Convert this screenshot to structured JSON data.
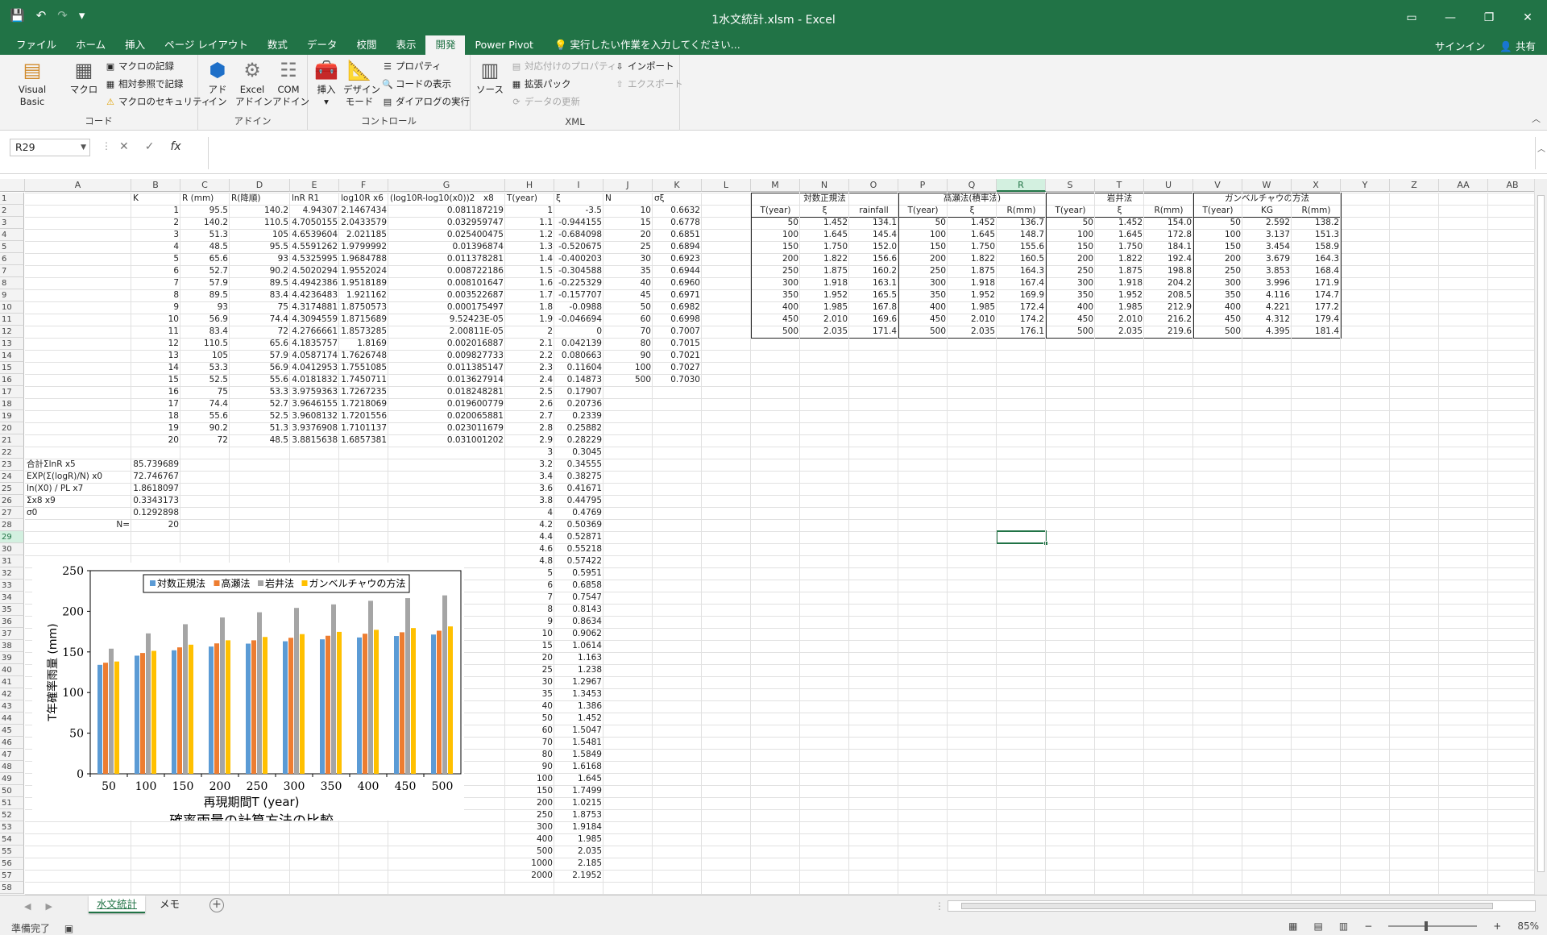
{
  "titlebar": {
    "title": "1水文統計.xlsm - Excel",
    "undo": "↶",
    "redo": "↷",
    "save": "💾",
    "customize": "▾"
  },
  "menu": {
    "tabs": [
      "ファイル",
      "ホーム",
      "挿入",
      "ページ レイアウト",
      "数式",
      "データ",
      "校閲",
      "表示",
      "開発",
      "Power Pivot"
    ],
    "active_index": 8,
    "tellme": "実行したい作業を入力してください...",
    "signin": "サインイン",
    "share": "共有"
  },
  "ribbon": {
    "code": {
      "label": "コード",
      "visual_basic": "Visual Basic",
      "macro": "マクロ",
      "record": "マクロの記録",
      "relative": "相対参照で記録",
      "security": "マクロのセキュリティ"
    },
    "addin": {
      "label": "アドイン",
      "addin": "アド\nイン",
      "excel_addin": "Excel\nアドイン",
      "com_addin": "COM\nアドイン"
    },
    "controls": {
      "label": "コントロール",
      "insert": "挿入",
      "design": "デザイン\nモード",
      "properties": "プロパティ",
      "view_code": "コードの表示",
      "dialog": "ダイアログの実行"
    },
    "xml": {
      "label": "XML",
      "source": "ソース",
      "map_props": "対応付けのプロパティ",
      "expansion": "拡張パック",
      "refresh": "データの更新",
      "import": "インポート",
      "export": "エクスポート"
    }
  },
  "namebox": "R29",
  "formula": "",
  "columns": [
    {
      "n": "A",
      "w": 132
    },
    {
      "n": "B",
      "w": 61
    },
    {
      "n": "C",
      "w": 61
    },
    {
      "n": "D",
      "w": 75
    },
    {
      "n": "E",
      "w": 61
    },
    {
      "n": "F",
      "w": 61
    },
    {
      "n": "G",
      "w": 145
    },
    {
      "n": "H",
      "w": 61
    },
    {
      "n": "I",
      "w": 61
    },
    {
      "n": "J",
      "w": 61
    },
    {
      "n": "K",
      "w": 61
    },
    {
      "n": "L",
      "w": 61
    },
    {
      "n": "M",
      "w": 61
    },
    {
      "n": "N",
      "w": 61
    },
    {
      "n": "O",
      "w": 61
    },
    {
      "n": "P",
      "w": 61
    },
    {
      "n": "Q",
      "w": 61
    },
    {
      "n": "R",
      "w": 61
    },
    {
      "n": "S",
      "w": 61
    },
    {
      "n": "T",
      "w": 61
    },
    {
      "n": "U",
      "w": 61
    },
    {
      "n": "V",
      "w": 61
    },
    {
      "n": "W",
      "w": 61
    },
    {
      "n": "X",
      "w": 61
    },
    {
      "n": "Y",
      "w": 61
    },
    {
      "n": "Z",
      "w": 61
    },
    {
      "n": "AA",
      "w": 61
    },
    {
      "n": "AB",
      "w": 61
    }
  ],
  "selected_col": "R",
  "selected_row": 29,
  "main_headers": {
    "B": "K",
    "C": "R (mm)",
    "D": "R(降順)",
    "E": "lnR R1",
    "F": "log10R x6",
    "G": "(log10R-log10(x0))2　x8",
    "H": "T(year)",
    "I": "ξ",
    "J": "N",
    "K": "σξ"
  },
  "main_rows": [
    [
      "1",
      "95.5",
      "140.2",
      "4.94307",
      "2.1467434",
      "0.081187219"
    ],
    [
      "2",
      "140.2",
      "110.5",
      "4.7050155",
      "2.0433579",
      "0.032959747"
    ],
    [
      "3",
      "51.3",
      "105",
      "4.6539604",
      "2.021185",
      "0.025400475"
    ],
    [
      "4",
      "48.5",
      "95.5",
      "4.5591262",
      "1.9799992",
      "0.01396874"
    ],
    [
      "5",
      "65.6",
      "93",
      "4.5325995",
      "1.9684788",
      "0.011378281"
    ],
    [
      "6",
      "52.7",
      "90.2",
      "4.5020294",
      "1.9552024",
      "0.008722186"
    ],
    [
      "7",
      "57.9",
      "89.5",
      "4.4942386",
      "1.9518189",
      "0.008101647"
    ],
    [
      "8",
      "89.5",
      "83.4",
      "4.4236483",
      "1.921162",
      "0.003522687"
    ],
    [
      "9",
      "93",
      "75",
      "4.3174881",
      "1.8750573",
      "0.000175497"
    ],
    [
      "10",
      "56.9",
      "74.4",
      "4.3094559",
      "1.8715689",
      "9.52423E-05"
    ],
    [
      "11",
      "83.4",
      "72",
      "4.2766661",
      "1.8573285",
      "2.00811E-05"
    ],
    [
      "12",
      "110.5",
      "65.6",
      "4.1835757",
      "1.8169",
      "0.002016887"
    ],
    [
      "13",
      "105",
      "57.9",
      "4.0587174",
      "1.7626748",
      "0.009827733"
    ],
    [
      "14",
      "53.3",
      "56.9",
      "4.0412953",
      "1.7551085",
      "0.011385147"
    ],
    [
      "15",
      "52.5",
      "55.6",
      "4.0181832",
      "1.7450711",
      "0.013627914"
    ],
    [
      "16",
      "75",
      "53.3",
      "3.9759363",
      "1.7267235",
      "0.018248281"
    ],
    [
      "17",
      "74.4",
      "52.7",
      "3.9646155",
      "1.7218069",
      "0.019600779"
    ],
    [
      "18",
      "55.6",
      "52.5",
      "3.9608132",
      "1.7201556",
      "0.020065881"
    ],
    [
      "19",
      "90.2",
      "51.3",
      "3.9376908",
      "1.7101137",
      "0.023011679"
    ],
    [
      "20",
      "72",
      "48.5",
      "3.8815638",
      "1.6857381",
      "0.031001202"
    ]
  ],
  "h_values": [
    "1",
    "1.1",
    "1.2",
    "1.3",
    "1.4",
    "1.5",
    "1.6",
    "1.7",
    "1.8",
    "1.9",
    "2",
    "2.1",
    "2.2",
    "2.3",
    "2.4",
    "2.5",
    "2.6",
    "2.7",
    "2.8",
    "2.9",
    "3",
    "3.2",
    "3.4",
    "3.6",
    "3.8",
    "4",
    "4.2",
    "4.4",
    "4.6",
    "4.8",
    "5",
    "6",
    "7",
    "8",
    "9",
    "10",
    "15",
    "20",
    "25",
    "30",
    "35",
    "40",
    "50",
    "60",
    "70",
    "80",
    "90",
    "100",
    "150",
    "200",
    "250",
    "300",
    "400",
    "500",
    "1000",
    "2000"
  ],
  "i_values": [
    "-3.5",
    "-0.944155",
    "-0.684098",
    "-0.520675",
    "-0.400203",
    "-0.304588",
    "-0.225329",
    "-0.157707",
    "-0.0988",
    "-0.046694",
    "0",
    "0.042139",
    "0.080663",
    "0.11604",
    "0.14873",
    "0.17907",
    "0.20736",
    "0.2339",
    "0.25882",
    "0.28229",
    "0.3045",
    "0.34555",
    "0.38275",
    "0.41671",
    "0.44795",
    "0.4769",
    "0.50369",
    "0.52871",
    "0.55218",
    "0.57422",
    "0.5951",
    "0.6858",
    "0.7547",
    "0.8143",
    "0.8634",
    "0.9062",
    "1.0614",
    "1.163",
    "1.238",
    "1.2967",
    "1.3453",
    "1.386",
    "1.452",
    "1.5047",
    "1.5481",
    "1.5849",
    "1.6168",
    "1.645",
    "1.7499",
    "1.0215",
    "1.8753",
    "1.9184",
    "1.985",
    "2.035",
    "2.185",
    "2.1952"
  ],
  "jk_rows": [
    [
      "10",
      "0.6632"
    ],
    [
      "15",
      "0.6778"
    ],
    [
      "20",
      "0.6851"
    ],
    [
      "25",
      "0.6894"
    ],
    [
      "30",
      "0.6923"
    ],
    [
      "35",
      "0.6944"
    ],
    [
      "40",
      "0.6960"
    ],
    [
      "45",
      "0.6971"
    ],
    [
      "50",
      "0.6982"
    ],
    [
      "60",
      "0.6998"
    ],
    [
      "70",
      "0.7007"
    ],
    [
      "80",
      "0.7015"
    ],
    [
      "90",
      "0.7021"
    ],
    [
      "100",
      "0.7027"
    ],
    [
      "500",
      "0.7030"
    ]
  ],
  "summary": [
    {
      "row": 22,
      "label": "",
      "value": ""
    },
    {
      "row": 23,
      "label": "合計ΣlnR  x5",
      "value": "85.739689"
    },
    {
      "row": 24,
      "label": "EXP(Σ(logR)/N)  x0",
      "value": "72.746767"
    },
    {
      "row": 25,
      "label": "ln(X0) / PL  x7",
      "value": "1.8618097"
    },
    {
      "row": 26,
      "label": "Σx8  x9",
      "value": "0.3343173"
    },
    {
      "row": 27,
      "label": "σ0",
      "value": "0.1292898"
    },
    {
      "row": 28,
      "label": "N=",
      "value": "20"
    }
  ],
  "methods": [
    {
      "title": "対数正規法",
      "headers": [
        "T(year)",
        "ξ",
        "rainfall"
      ],
      "rows": [
        [
          "50",
          "1.452",
          "134.1"
        ],
        [
          "100",
          "1.645",
          "145.4"
        ],
        [
          "150",
          "1.750",
          "152.0"
        ],
        [
          "200",
          "1.822",
          "156.6"
        ],
        [
          "250",
          "1.875",
          "160.2"
        ],
        [
          "300",
          "1.918",
          "163.1"
        ],
        [
          "350",
          "1.952",
          "165.5"
        ],
        [
          "400",
          "1.985",
          "167.8"
        ],
        [
          "450",
          "2.010",
          "169.6"
        ],
        [
          "500",
          "2.035",
          "171.4"
        ]
      ]
    },
    {
      "title": "高瀬法(積率法)",
      "headers": [
        "T(year)",
        "ξ",
        "R(mm)"
      ],
      "rows": [
        [
          "50",
          "1.452",
          "136.7"
        ],
        [
          "100",
          "1.645",
          "148.7"
        ],
        [
          "150",
          "1.750",
          "155.6"
        ],
        [
          "200",
          "1.822",
          "160.5"
        ],
        [
          "250",
          "1.875",
          "164.3"
        ],
        [
          "300",
          "1.918",
          "167.4"
        ],
        [
          "350",
          "1.952",
          "169.9"
        ],
        [
          "400",
          "1.985",
          "172.4"
        ],
        [
          "450",
          "2.010",
          "174.2"
        ],
        [
          "500",
          "2.035",
          "176.1"
        ]
      ]
    },
    {
      "title": "岩井法",
      "headers": [
        "T(year)",
        "ξ",
        "R(mm)"
      ],
      "rows": [
        [
          "50",
          "1.452",
          "154.0"
        ],
        [
          "100",
          "1.645",
          "172.8"
        ],
        [
          "150",
          "1.750",
          "184.1"
        ],
        [
          "200",
          "1.822",
          "192.4"
        ],
        [
          "250",
          "1.875",
          "198.8"
        ],
        [
          "300",
          "1.918",
          "204.2"
        ],
        [
          "350",
          "1.952",
          "208.5"
        ],
        [
          "400",
          "1.985",
          "212.9"
        ],
        [
          "450",
          "2.010",
          "216.2"
        ],
        [
          "500",
          "2.035",
          "219.6"
        ]
      ]
    },
    {
      "title": "ガンベルチャウの方法",
      "headers": [
        "T(year)",
        "KG",
        "R(mm)"
      ],
      "rows": [
        [
          "50",
          "2.592",
          "138.2"
        ],
        [
          "100",
          "3.137",
          "151.3"
        ],
        [
          "150",
          "3.454",
          "158.9"
        ],
        [
          "200",
          "3.679",
          "164.3"
        ],
        [
          "250",
          "3.853",
          "168.4"
        ],
        [
          "300",
          "3.996",
          "171.9"
        ],
        [
          "350",
          "4.116",
          "174.7"
        ],
        [
          "400",
          "4.221",
          "177.2"
        ],
        [
          "450",
          "4.312",
          "179.4"
        ],
        [
          "500",
          "4.395",
          "181.4"
        ]
      ]
    }
  ],
  "chart_data": {
    "type": "bar",
    "title": "確率雨量の計算方法の比較",
    "xlabel": "再現期間T (year)",
    "ylabel": "T年確率雨量 (mm)",
    "ylim": [
      0,
      250
    ],
    "yticks": [
      "0",
      "50",
      "100",
      "150",
      "200",
      "250"
    ],
    "categories": [
      "50",
      "100",
      "150",
      "200",
      "250",
      "300",
      "350",
      "400",
      "450",
      "500"
    ],
    "legend_position": "top",
    "series": [
      {
        "name": "対数正規法",
        "color": "#5b9bd5",
        "values": [
          134.1,
          145.4,
          152.0,
          156.6,
          160.2,
          163.1,
          165.5,
          167.8,
          169.6,
          171.4
        ]
      },
      {
        "name": "高瀬法",
        "color": "#ed7d31",
        "values": [
          136.7,
          148.7,
          155.6,
          160.5,
          164.3,
          167.4,
          169.9,
          172.4,
          174.2,
          176.1
        ]
      },
      {
        "name": "岩井法",
        "color": "#a5a5a5",
        "values": [
          154.0,
          172.8,
          184.1,
          192.4,
          198.8,
          204.2,
          208.5,
          212.9,
          216.2,
          219.6
        ]
      },
      {
        "name": "ガンベルチャウの方法",
        "color": "#ffc000",
        "values": [
          138.2,
          151.3,
          158.9,
          164.3,
          168.4,
          171.9,
          174.7,
          177.2,
          179.4,
          181.4
        ]
      }
    ]
  },
  "sheets": [
    {
      "name": "水文統計",
      "active": true
    },
    {
      "name": "メモ",
      "active": false
    }
  ],
  "status": {
    "ready": "準備完了",
    "zoom": "85%"
  }
}
